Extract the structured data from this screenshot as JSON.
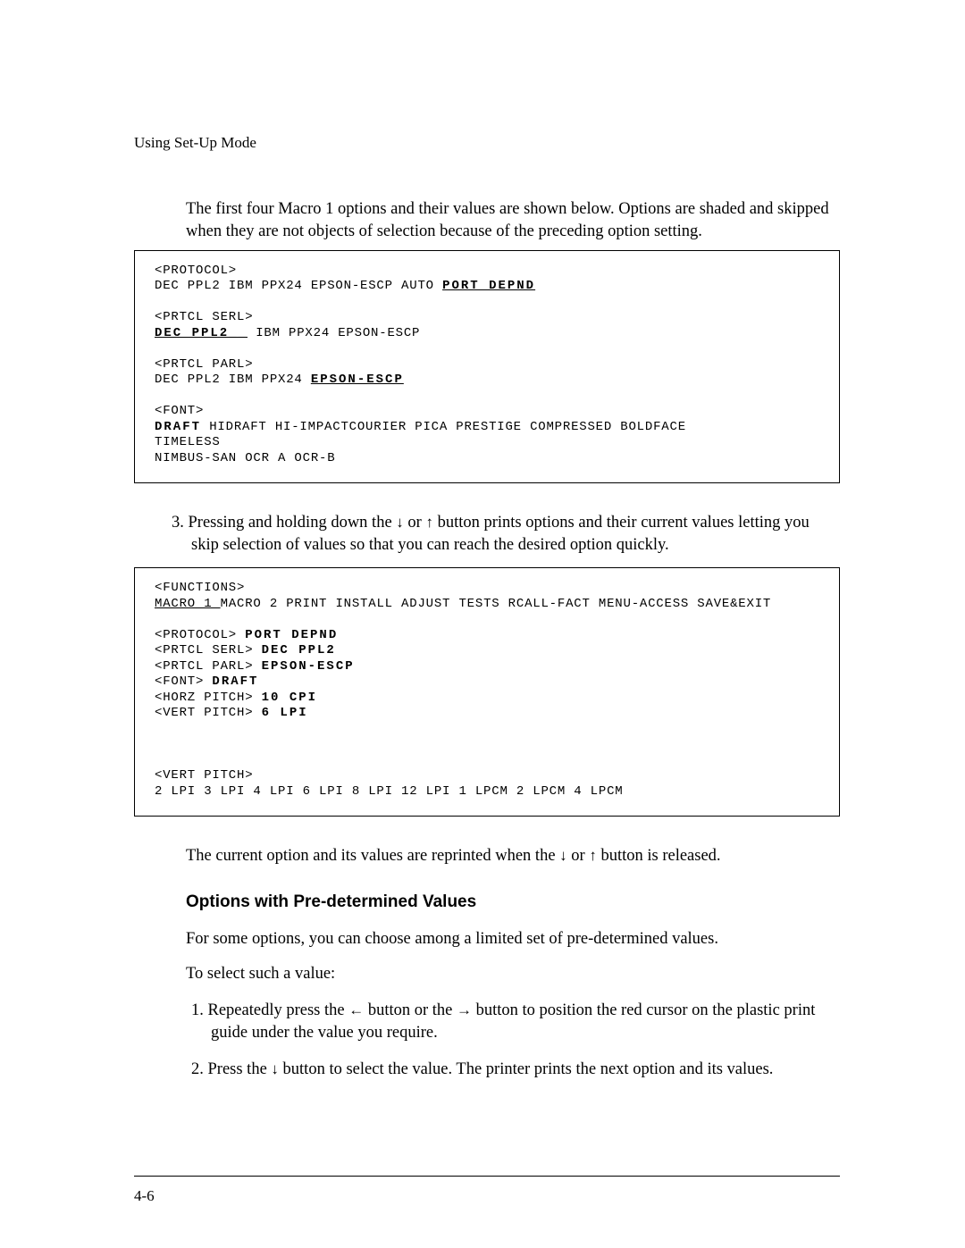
{
  "header": {
    "section": "Using Set-Up Mode"
  },
  "intro": "The first four Macro 1 options and their values are shown below.  Options are shaded and skipped when they are not objects of selection because of the preceding option setting.",
  "box1": {
    "l1": "<PROTOCOL>",
    "l2a": "DEC  PPL2  IBM  PPX24 EPSON-ESCP         AUTO    ",
    "l2b": "PORT   DEPND",
    "l3": "<PRTCL  SERL>",
    "l4a": "DEC   PPL2__",
    "l4b": "       IBM  PPX24 EPSON-ESCP",
    "l5": "<PRTCL  PARL>",
    "l6a": "DEC  PPL2  IBM  PPX24 ",
    "l6b": "EPSON-ESCP",
    "l7": "<FONT>",
    "l8a": "DRAFT",
    "l8b": "   HIDRAFT  HI-IMPACTCOURIER  PICA    PRESTIGE COMPRESSED       BOLDFACE",
    "l9": "TIMELESS",
    "l10": "NIMBUS-SAN         OCR  A    OCR-B"
  },
  "step3a": "3.  Pressing and holding down the ",
  "step3b": "  or  ",
  "step3c": " button prints options and their current values letting you skip selection of values so that you can reach the desired option quickly.",
  "box2": {
    "l1": "<FUNCTIONS>",
    "l2a": "MACRO 1 ",
    "l2b": "MACRO 2 PRINT  INSTALL ADJUST TESTS  RCALL-FACT MENU-ACCESS SAVE&EXIT",
    "l3a": "<PROTOCOL>               ",
    "l3b": "PORT   DEPND",
    "l4a": "<PRTCL  SERL>       ",
    "l4b": "DEC   PPL2",
    "l5a": "<PRTCL  PARL>       ",
    "l5b": "EPSON-ESCP",
    "l6a": "<FONT>              ",
    "l6b": "DRAFT",
    "l7a": "<HORZ  PITCH>       ",
    "l7b": "10     CPI",
    "l8a": "<VERT  PITCH>       ",
    "l8b": "6    LPI",
    "l9": "<VERT  PITCH>",
    "l10": "2   LPI   3   LPI   4   LPI   6   LPI   8   LPI   12  LPI   1   LPCM   2   LPCM   4   LPCM"
  },
  "after_box2a": "The current option and its values are reprinted when the ",
  "after_box2b": "  or  ",
  "after_box2c": " button is released.",
  "heading": "Options with Pre-determined Values",
  "para2": "For some options, you can choose among a limited set of pre-determined values.",
  "para3": "To select such a value:",
  "ol1a": "1.  Repeatedly press the ",
  "ol1b": " button or the ",
  "ol1c": " button to position the red cursor on the plastic print guide under the value you require.",
  "ol2a": "2.  Press the ",
  "ol2b": " button to select the value.  The printer prints the next option and its values.",
  "pagenum": "4-6",
  "arrows": {
    "down": "↓",
    "up": "↑",
    "left": "←",
    "right": "→"
  }
}
